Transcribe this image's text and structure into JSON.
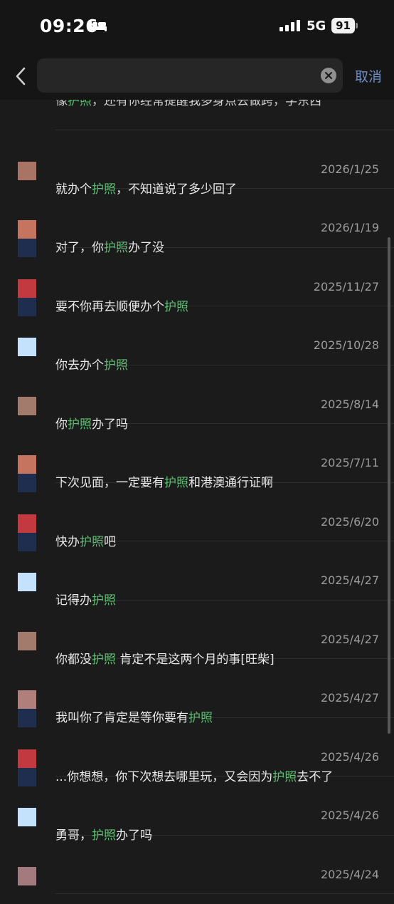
{
  "status_bar": {
    "time": "09:26",
    "network": "5G",
    "battery": "91"
  },
  "search": {
    "placeholder": "",
    "value": "",
    "cancel_label": "取消"
  },
  "results": [
    {
      "date": "",
      "before": "像",
      "keyword": "护照",
      "after": "，还有你经常提醒我多身点去做跨，学东西",
      "avatar": [
        "#5a4a44",
        "#1b1b1b"
      ]
    },
    {
      "date": "2026/1/25",
      "before": "就办个",
      "keyword": "护照",
      "after": "，不知道说了多少回了",
      "avatar": [
        "#a97466",
        "#1b1b1b"
      ]
    },
    {
      "date": "2026/1/19",
      "before": "对了，你",
      "keyword": "护照",
      "after": "办了没",
      "avatar": [
        "#c57460",
        "#1f2d4f"
      ]
    },
    {
      "date": "2025/11/27",
      "before": "要不你再去顺便办个",
      "keyword": "护照",
      "after": "",
      "avatar": [
        "#c23a3f",
        "#1f2d4f"
      ]
    },
    {
      "date": "2025/10/28",
      "before": "你去办个",
      "keyword": "护照",
      "after": "",
      "avatar": [
        "#c4e2fb",
        "#1b1b1b"
      ]
    },
    {
      "date": "2025/8/14",
      "before": "你",
      "keyword": "护照",
      "after": "办了吗",
      "avatar": [
        "#a37b6d",
        "#1b1b1b"
      ]
    },
    {
      "date": "2025/7/11",
      "before": "下次见面，一定要有",
      "keyword": "护照",
      "after": "和港澳通行证啊",
      "avatar": [
        "#c57460",
        "#1f2d4f"
      ]
    },
    {
      "date": "2025/6/20",
      "before": "快办",
      "keyword": "护照",
      "after": "吧",
      "avatar": [
        "#c23a3f",
        "#1f2d4f"
      ]
    },
    {
      "date": "2025/4/27",
      "before": "记得办",
      "keyword": "护照",
      "after": "",
      "avatar": [
        "#c4e2fb",
        "#1b1b1b"
      ]
    },
    {
      "date": "2025/4/27",
      "before": "你都没",
      "keyword": "护照",
      "after": " 肯定不是这两个月的事[旺柴]",
      "avatar": [
        "#a37b6d",
        "#1b1b1b"
      ]
    },
    {
      "date": "2025/4/27",
      "before": "我叫你了肯定是等你要有",
      "keyword": "护照",
      "after": "",
      "avatar": [
        "#b07f7c",
        "#1f2d4f"
      ]
    },
    {
      "date": "2025/4/26",
      "before": "...你想想，你下次想去哪里玩，又会因为",
      "keyword": "护照",
      "after": "去不了",
      "avatar": [
        "#c23a3f",
        "#1f2d4f"
      ]
    },
    {
      "date": "2025/4/26",
      "before": "勇哥，",
      "keyword": "护照",
      "after": "办了吗",
      "avatar": [
        "#c4e2fb",
        "#1b1b1b"
      ]
    },
    {
      "date": "2025/4/24",
      "before": "",
      "keyword": "",
      "after": "",
      "avatar": [
        "#a37b7f",
        "#1b1b1b"
      ]
    }
  ]
}
